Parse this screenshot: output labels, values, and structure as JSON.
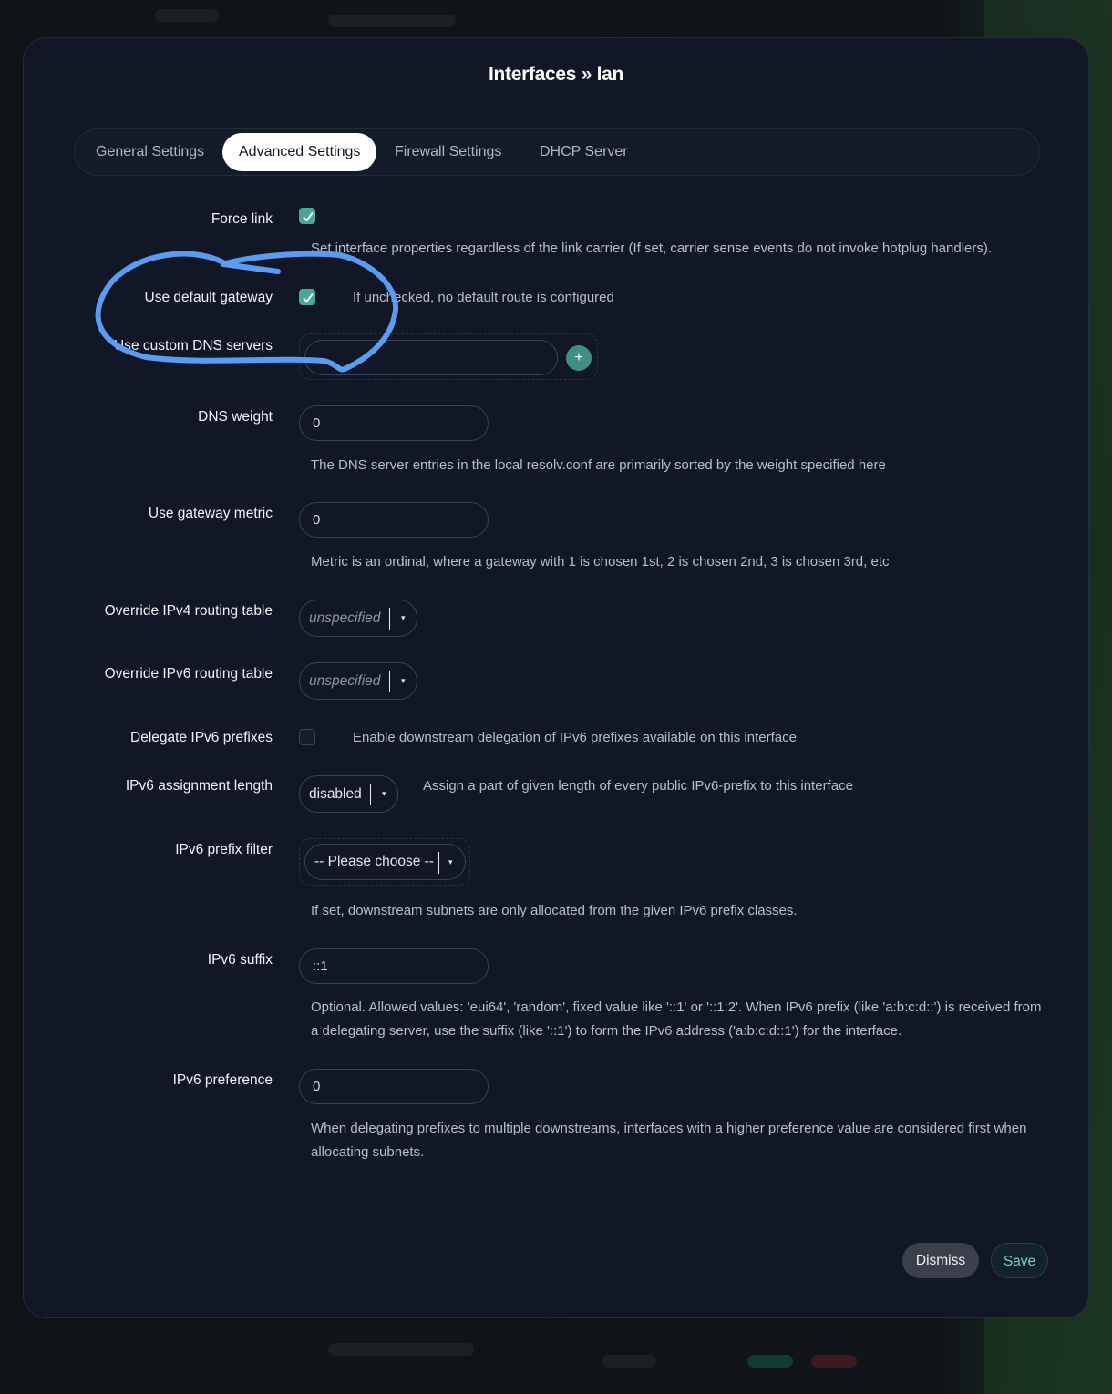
{
  "modal": {
    "title": "Interfaces » lan"
  },
  "tabs": [
    {
      "label": "General Settings",
      "active": false
    },
    {
      "label": "Advanced Settings",
      "active": true
    },
    {
      "label": "Firewall Settings",
      "active": false
    },
    {
      "label": "DHCP Server",
      "active": false
    }
  ],
  "fields": {
    "force_link": {
      "label": "Force link",
      "checked": true,
      "help": "Set interface properties regardless of the link carrier (If set, carrier sense events do not invoke hotplug handlers)."
    },
    "default_gateway": {
      "label": "Use default gateway",
      "checked": true,
      "help": "If unchecked, no default route is configured"
    },
    "custom_dns": {
      "label": "Use custom DNS servers",
      "value": "",
      "add_icon": "plus-icon",
      "add_symbol": "+"
    },
    "dns_weight": {
      "label": "DNS weight",
      "value": "0",
      "help": "The DNS server entries in the local resolv.conf are primarily sorted by the weight specified here"
    },
    "gateway_metric": {
      "label": "Use gateway metric",
      "value": "0",
      "help": "Metric is an ordinal, where a gateway with 1 is chosen 1st, 2 is chosen 2nd, 3 is chosen 3rd, etc"
    },
    "ipv4_table": {
      "label": "Override IPv4 routing table",
      "value": "unspecified"
    },
    "ipv6_table": {
      "label": "Override IPv6 routing table",
      "value": "unspecified"
    },
    "delegate": {
      "label": "Delegate IPv6 prefixes",
      "checked": false,
      "help": "Enable downstream delegation of IPv6 prefixes available on this interface"
    },
    "assign_length": {
      "label": "IPv6 assignment length",
      "value": "disabled",
      "help": "Assign a part of given length of every public IPv6-prefix to this interface"
    },
    "prefix_filter": {
      "label": "IPv6 prefix filter",
      "value": "-- Please choose --",
      "help": "If set, downstream subnets are only allocated from the given IPv6 prefix classes."
    },
    "suffix": {
      "label": "IPv6 suffix",
      "value": "::1",
      "help": "Optional. Allowed values: 'eui64', 'random', fixed value like '::1' or '::1:2'. When IPv6 prefix (like 'a:b:c:d::') is received from a delegating server, use the suffix (like '::1') to form the IPv6 address ('a:b:c:d::1') for the interface."
    },
    "preference": {
      "label": "IPv6 preference",
      "value": "0",
      "help": "When delegating prefixes to multiple downstreams, interfaces with a higher preference value are considered first when allocating subnets."
    }
  },
  "footer": {
    "dismiss_label": "Dismiss",
    "save_label": "Save"
  },
  "colors": {
    "accent": "#4aa698",
    "annotation": "#5b9cf0",
    "modal_bg": "#111726"
  },
  "caret_symbol": "▾"
}
